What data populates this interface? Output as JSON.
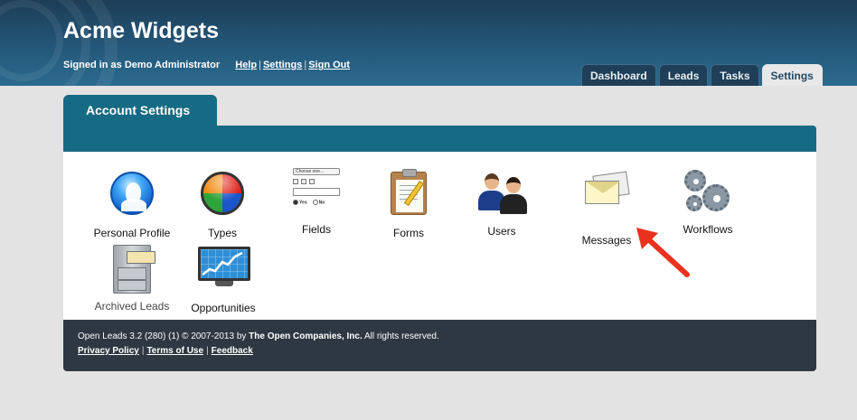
{
  "header": {
    "title": "Acme Widgets",
    "signed_in_text": "Signed in as Demo Administrator",
    "links": {
      "help": "Help",
      "settings": "Settings",
      "sign_out": "Sign Out"
    },
    "separator": "|"
  },
  "main_tabs": [
    {
      "label": "Dashboard",
      "active": false
    },
    {
      "label": "Leads",
      "active": false
    },
    {
      "label": "Tasks",
      "active": false
    },
    {
      "label": "Settings",
      "active": true
    }
  ],
  "sub_tab": {
    "label": "Account Settings"
  },
  "settings_items": [
    {
      "label": "Personal Profile",
      "icon": "user-profile-icon"
    },
    {
      "label": "Types",
      "icon": "color-orb-icon"
    },
    {
      "label": "Fields",
      "icon": "form-fields-icon"
    },
    {
      "label": "Forms",
      "icon": "clipboard-icon"
    },
    {
      "label": "Users",
      "icon": "users-icon"
    },
    {
      "label": "Messages",
      "icon": "envelopes-icon"
    },
    {
      "label": "Workflows",
      "icon": "gears-icon"
    },
    {
      "label": "Archived Leads",
      "icon": "file-cabinet-icon"
    },
    {
      "label": "Opportunities",
      "icon": "chart-monitor-icon"
    }
  ],
  "fields_icon_text": {
    "select": "Choose one...",
    "yes": "Yes",
    "no": "No"
  },
  "footer": {
    "copyright_prefix": "Open Leads 3.2 (280) (1) © 2007-2013 by ",
    "company": "The Open Companies, Inc.",
    "copyright_suffix": " All rights reserved.",
    "links": {
      "privacy": "Privacy Policy",
      "terms": "Terms of Use",
      "feedback": "Feedback"
    },
    "separator": "|"
  },
  "colors": {
    "header": "#245a7c",
    "teal": "#176a84",
    "footer": "#2e3842",
    "annotation_arrow": "#e8321e"
  }
}
